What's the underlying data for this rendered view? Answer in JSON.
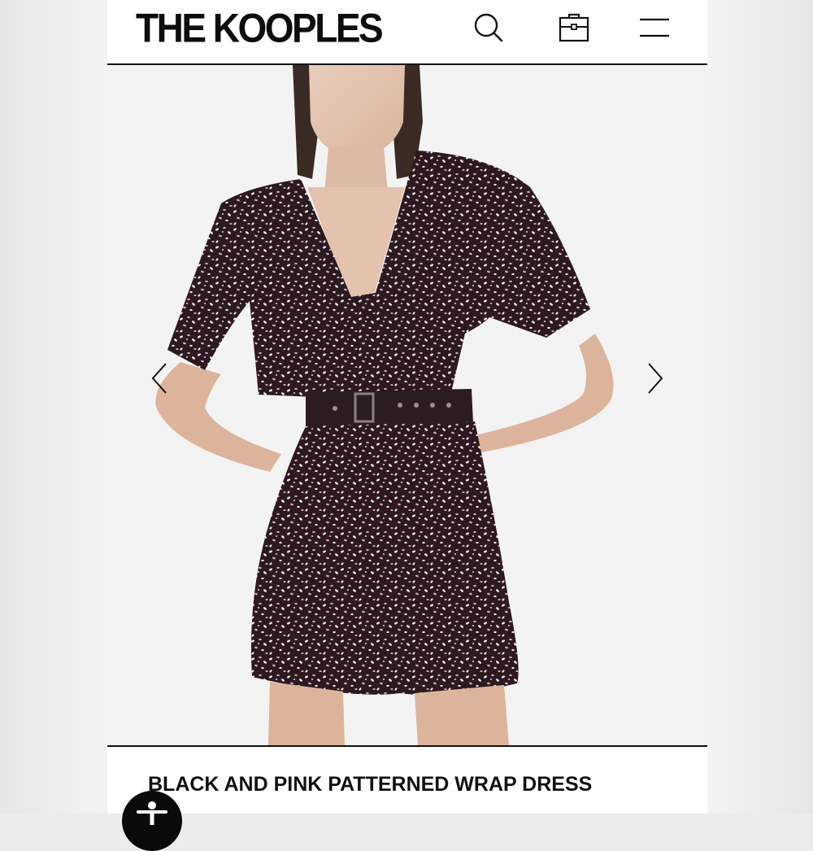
{
  "header": {
    "brand": "THE KOOPLES",
    "icons": [
      "search-icon",
      "shopping-bag-icon",
      "hamburger-menu-icon"
    ]
  },
  "gallery": {
    "image": "model-wearing-patterned-wrap-dress",
    "prev_icon": "chevron-left-icon",
    "next_icon": "chevron-right-icon",
    "background": "#f4f3f3"
  },
  "product": {
    "title": "BLACK AND PINK PATTERNED WRAP DRESS"
  },
  "accessibility": {
    "icon": "accessibility-icon"
  },
  "colors": {
    "text": "#111111",
    "dress_base": "#2b1b20",
    "dress_pattern_pink": "#d9a5c2",
    "dress_pattern_white": "#f1e6ec"
  }
}
